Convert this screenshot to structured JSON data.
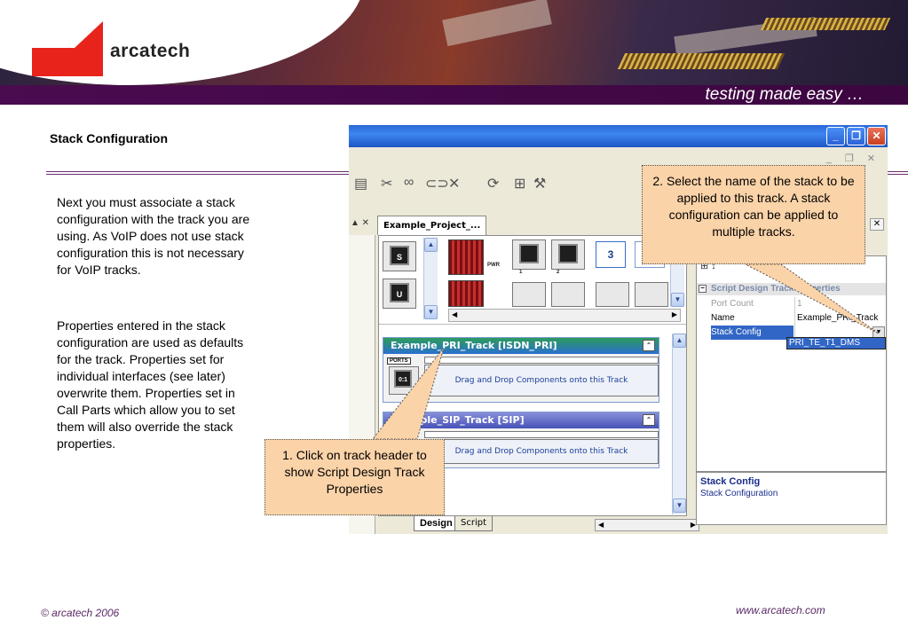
{
  "header": {
    "brand_name": "arcatech",
    "tagline": "testing made easy …",
    "brand_red": "#e8231c",
    "band_color": "#4b0b4f"
  },
  "slide": {
    "title": "Stack Configuration",
    "paragraph1": "Next you must associate a stack configuration with the track you are using. As VoIP does not use stack configuration this is not necessary for VoIP tracks.",
    "paragraph2": "Properties entered in the stack configuration are used as defaults for the track. Properties set for individual interfaces (see later) overwrite them. Properties set in Call Parts which allow you to set them will also override the stack properties."
  },
  "footer": {
    "copyright": "© arcatech 2006",
    "website": "www.arcatech.com"
  },
  "app": {
    "document_tab": "Example_Project_...",
    "palette": {
      "comp_s": "S",
      "comp_u": "U",
      "box_3": "3",
      "led_pwr": "PWR",
      "led_1": "1",
      "led_2": "2"
    },
    "tracks": [
      {
        "title": "Example_PRI_Track [ISDN_PRI]",
        "ports_label": "PORTS",
        "port_id": "0:1",
        "drop_text": "Drag and Drop Components onto this Track"
      },
      {
        "title": "Example_SIP_Track [SIP]",
        "drop_text": "Drag and Drop Components onto this Track"
      }
    ],
    "bottom_tabs": {
      "design": "Design",
      "script": "Script"
    },
    "properties": {
      "category": "Script Design Track Properties",
      "rows": [
        {
          "key": "Port Count",
          "value": "1"
        },
        {
          "key": "Name",
          "value": "Example_PRI_Track"
        },
        {
          "key": "Stack Config",
          "value": ""
        }
      ],
      "dropdown_selected": "PRI_TE_T1_DMS"
    },
    "description": {
      "title": "Stack Config",
      "text": "Stack Configuration"
    }
  },
  "callouts": {
    "step1": "1. Click on track header to show Script Design Track Properties",
    "step2": "2. Select the name of the stack to be applied to this track. A stack configuration can be applied to multiple tracks."
  }
}
